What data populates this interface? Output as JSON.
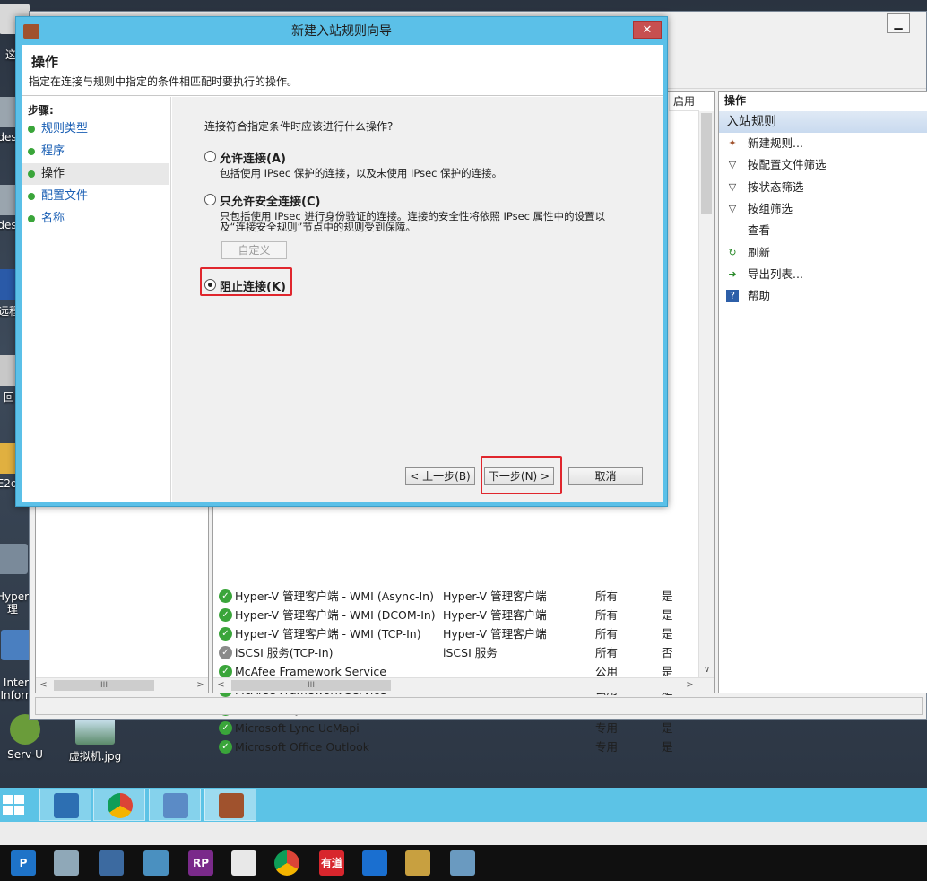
{
  "desktop": {
    "icons": [
      {
        "label": "这"
      },
      {
        "label": "des"
      },
      {
        "label": "des"
      },
      {
        "label": "远程"
      },
      {
        "label": "回"
      },
      {
        "label": "E2o"
      },
      {
        "label": "Hyper\n理"
      },
      {
        "label": "Inter\nInforn"
      },
      {
        "label": "Serv-U"
      },
      {
        "label": "虚拟机.jpg"
      }
    ]
  },
  "mmc": {
    "columns": {
      "enabled": "启用"
    },
    "rules": [
      {
        "name": "Hyper-V 管理客户端 - WMI (Async-In)",
        "group": "Hyper-V 管理客户端",
        "profile": "所有",
        "enabled": "是",
        "status": "ok"
      },
      {
        "name": "Hyper-V 管理客户端 - WMI (DCOM-In)",
        "group": "Hyper-V 管理客户端",
        "profile": "所有",
        "enabled": "是",
        "status": "ok"
      },
      {
        "name": "Hyper-V 管理客户端 - WMI (TCP-In)",
        "group": "Hyper-V 管理客户端",
        "profile": "所有",
        "enabled": "是",
        "status": "ok"
      },
      {
        "name": "iSCSI 服务(TCP-In)",
        "group": "iSCSI 服务",
        "profile": "所有",
        "enabled": "否",
        "status": "disabled"
      },
      {
        "name": "McAfee Framework Service",
        "group": "",
        "profile": "公用",
        "enabled": "是",
        "status": "ok"
      },
      {
        "name": "McAfee Framework Service",
        "group": "",
        "profile": "公用",
        "enabled": "是",
        "status": "ok"
      },
      {
        "name": "Microsoft Lync",
        "group": "",
        "profile": "专用",
        "enabled": "是",
        "status": "ok"
      },
      {
        "name": "Microsoft Lync UcMapi",
        "group": "",
        "profile": "专用",
        "enabled": "是",
        "status": "ok"
      },
      {
        "name": "Microsoft Office Outlook",
        "group": "",
        "profile": "专用",
        "enabled": "是",
        "status": "ok"
      }
    ],
    "actions_pane": {
      "header": "操作",
      "section": "入站规则",
      "items": [
        {
          "label": "新建规则...",
          "icon": "new-rule-icon"
        },
        {
          "label": "按配置文件筛选",
          "icon": "filter-icon"
        },
        {
          "label": "按状态筛选",
          "icon": "filter-icon"
        },
        {
          "label": "按组筛选",
          "icon": "filter-icon"
        },
        {
          "label": "查看",
          "icon": "none"
        },
        {
          "label": "刷新",
          "icon": "refresh-icon"
        },
        {
          "label": "导出列表...",
          "icon": "export-icon"
        },
        {
          "label": "帮助",
          "icon": "help-icon"
        }
      ]
    }
  },
  "wizard": {
    "title": "新建入站规则向导",
    "close_glyph": "✕",
    "header_title": "操作",
    "header_desc": "指定在连接与规则中指定的条件相匹配时要执行的操作。",
    "steps_title": "步骤:",
    "steps": [
      {
        "label": "规则类型",
        "active": false
      },
      {
        "label": "程序",
        "active": false
      },
      {
        "label": "操作",
        "active": true
      },
      {
        "label": "配置文件",
        "active": false
      },
      {
        "label": "名称",
        "active": false
      }
    ],
    "question": "连接符合指定条件时应该进行什么操作?",
    "options": [
      {
        "label": "允许连接(A)",
        "desc": "包括使用 IPsec 保护的连接，以及未使用 IPsec 保护的连接。",
        "checked": false
      },
      {
        "label": "只允许安全连接(C)",
        "desc": "只包括使用 IPsec 进行身份验证的连接。连接的安全性将依照 IPsec 属性中的设置以及“连接安全规则”节点中的规则受到保障。",
        "checked": false
      },
      {
        "label": "阻止连接(K)",
        "desc": "",
        "checked": true
      }
    ],
    "customize_button": "自定义",
    "back_button": "< 上一步(B)",
    "next_button": "下一步(N) >",
    "cancel_button": "取消"
  },
  "taskbar_top": {
    "buttons": [
      "start-icon",
      "server-manager-icon",
      "chrome-icon",
      "control-panel-icon",
      "firewall-icon"
    ]
  },
  "taskbar_bottom": {
    "buttons": [
      {
        "icon": "p-app-icon",
        "text": "P"
      },
      {
        "icon": "app-icon",
        "text": ""
      },
      {
        "icon": "app-icon",
        "text": ""
      },
      {
        "icon": "app-icon",
        "text": ""
      },
      {
        "icon": "axure-rp-icon",
        "text": "RP"
      },
      {
        "icon": "calculator-icon",
        "text": ""
      },
      {
        "icon": "chrome-icon",
        "text": ""
      },
      {
        "icon": "youdao-icon",
        "text": "有道"
      },
      {
        "icon": "teamviewer-icon",
        "text": ""
      },
      {
        "icon": "app-icon",
        "text": ""
      },
      {
        "icon": "app-icon",
        "text": ""
      }
    ]
  }
}
